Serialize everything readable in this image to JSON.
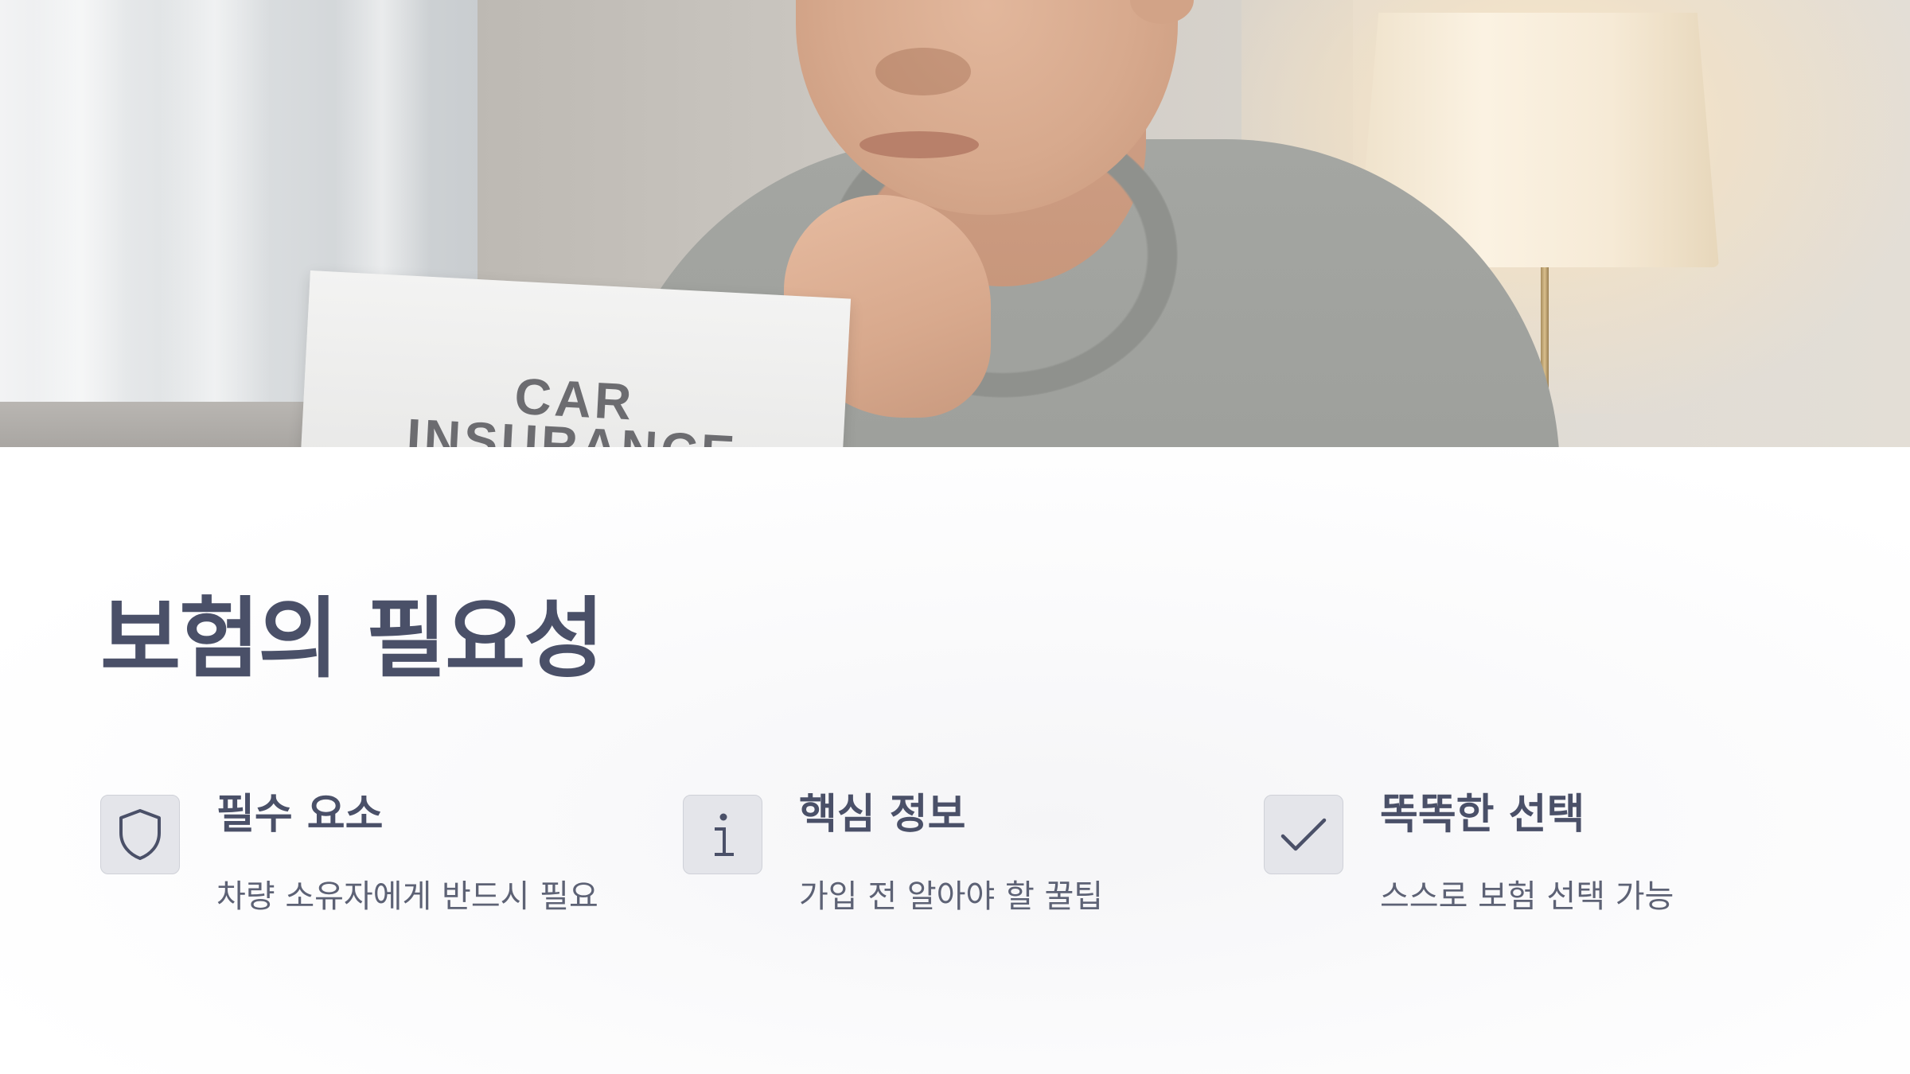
{
  "hero": {
    "paper_text_line1": "CAR",
    "paper_text_line2": "INSURANCE"
  },
  "section": {
    "title": "보험의 필요성"
  },
  "features": [
    {
      "icon": "shield-icon",
      "title": "필수 요소",
      "description": "차량 소유자에게 반드시 필요"
    },
    {
      "icon": "info-icon",
      "title": "핵심 정보",
      "description": "가입 전 알아야 할 꿀팁"
    },
    {
      "icon": "check-icon",
      "title": "똑똑한 선택",
      "description": "스스로 보험 선택 가능"
    }
  ],
  "colors": {
    "heading": "#4a5068",
    "body_text": "#5d6275",
    "icon_bg": "#e4e5ea",
    "icon_stroke": "#4a5068"
  }
}
